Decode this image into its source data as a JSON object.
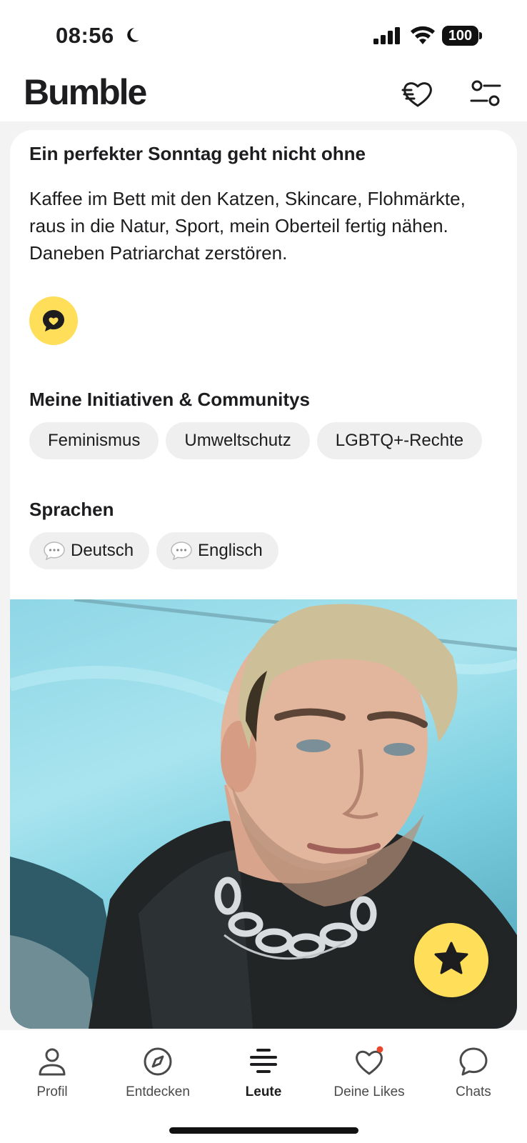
{
  "status_bar": {
    "time": "08:56",
    "battery": "100",
    "icons": [
      "moon-icon",
      "signal-icon",
      "wifi-icon",
      "battery-icon"
    ]
  },
  "header": {
    "logo": "Bumble",
    "icons": [
      "likes-heart-icon",
      "filter-icon"
    ]
  },
  "prompt": {
    "question": "Ein perfekter Sonntag geht nicht ohne",
    "answer": "Kaffee im Bett mit den Katzen, Skincare, Flohmärkte, raus in die Natur, Sport, mein Oberteil fertig nähen. Daneben Patriarchat zerstören.",
    "icon": "chat-heart-icon"
  },
  "communities": {
    "title": "Meine Initiativen & Communitys",
    "chips": [
      "Feminismus",
      "Umweltschutz",
      "LGBTQ+-Rechte"
    ]
  },
  "languages": {
    "title": "Sprachen",
    "chips": [
      "Deutsch",
      "Englisch"
    ],
    "icon": "speech-bubble-icon"
  },
  "photo": {
    "icon": "star-icon"
  },
  "bottom_nav": {
    "items": [
      {
        "label": "Profil",
        "icon": "profile-icon"
      },
      {
        "label": "Entdecken",
        "icon": "compass-icon"
      },
      {
        "label": "Leute",
        "icon": "people-stack-icon",
        "active": true
      },
      {
        "label": "Deine Likes",
        "icon": "heart-icon",
        "badge_color": "#e8472b"
      },
      {
        "label": "Chats",
        "icon": "chat-icon"
      }
    ]
  },
  "colors": {
    "accent_yellow": "#ffde5a",
    "notification_red": "#e8472b"
  }
}
